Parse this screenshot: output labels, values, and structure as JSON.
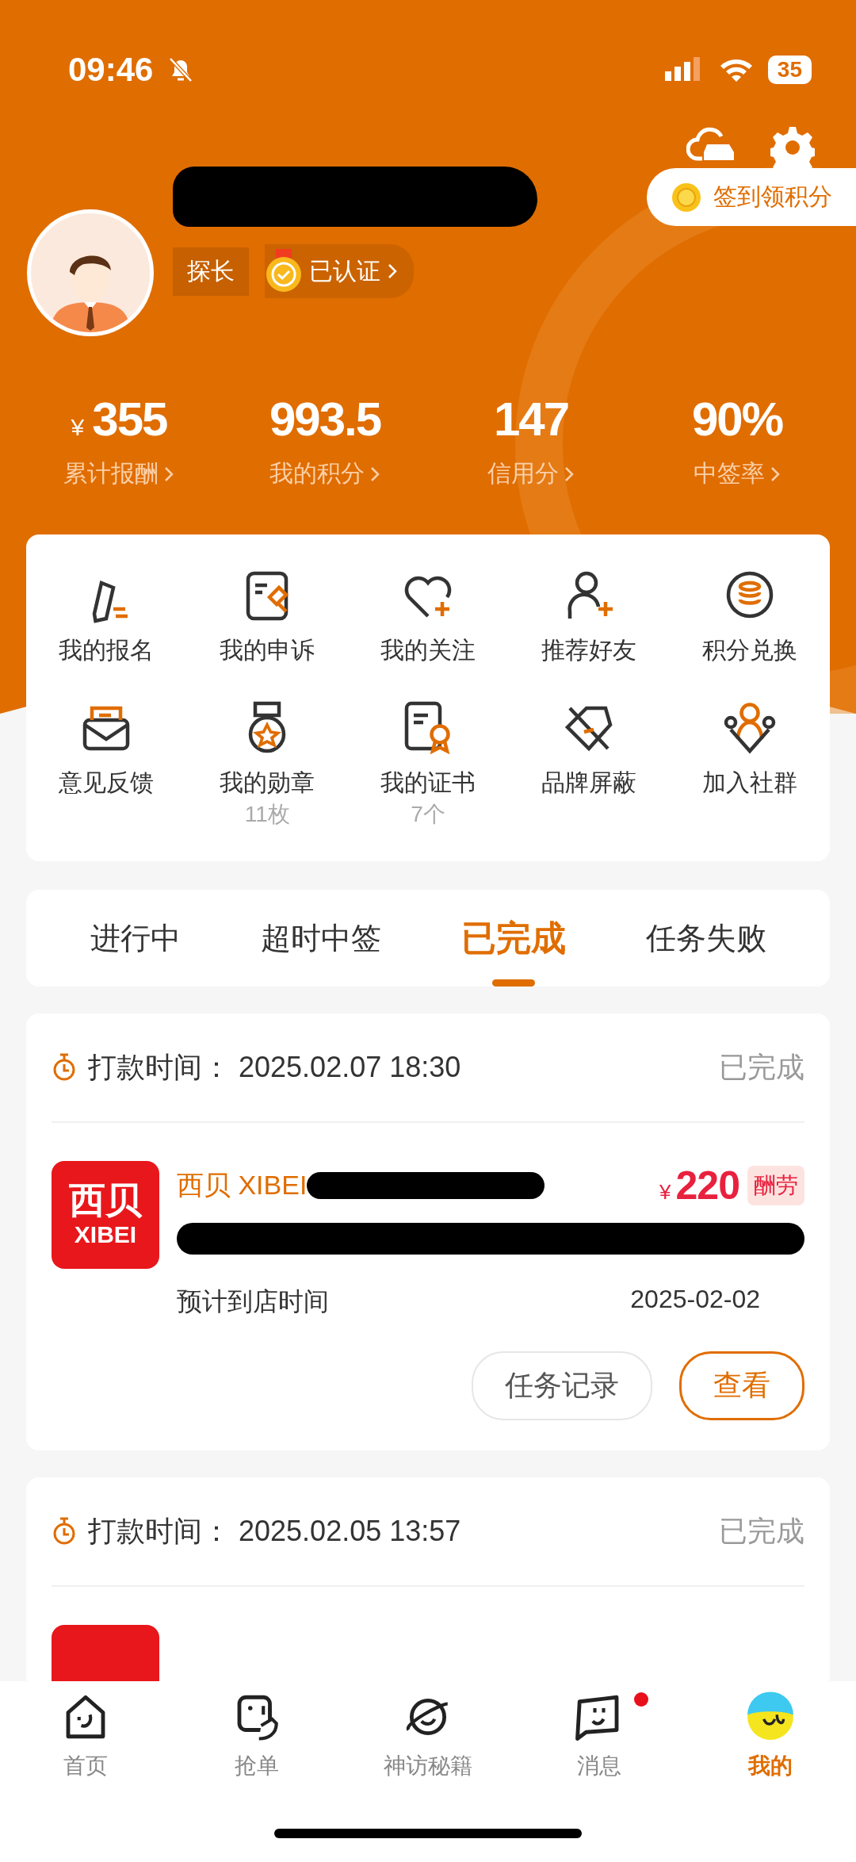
{
  "status_bar": {
    "time": "09:46",
    "battery": "35"
  },
  "profile": {
    "role": "探长",
    "verified": "已认证",
    "checkin": "签到领积分"
  },
  "stats": [
    {
      "currency": "¥",
      "value": "355",
      "label": "累计报酬"
    },
    {
      "value": "993.5",
      "label": "我的积分"
    },
    {
      "value": "147",
      "label": "信用分"
    },
    {
      "value": "90%",
      "label": "中签率"
    }
  ],
  "shortcuts": [
    {
      "label": "我的报名"
    },
    {
      "label": "我的申诉"
    },
    {
      "label": "我的关注"
    },
    {
      "label": "推荐好友"
    },
    {
      "label": "积分兑换"
    },
    {
      "label": "意见反馈"
    },
    {
      "label": "我的勋章",
      "sub": "11枚"
    },
    {
      "label": "我的证书",
      "sub": "7个"
    },
    {
      "label": "品牌屏蔽"
    },
    {
      "label": "加入社群"
    }
  ],
  "tabs": [
    {
      "label": "进行中",
      "selected": false
    },
    {
      "label": "超时中签",
      "selected": false
    },
    {
      "label": "已完成",
      "selected": true
    },
    {
      "label": "任务失败",
      "selected": false
    }
  ],
  "tasks": [
    {
      "payment_label": "打款时间：",
      "payment_time": "2025.02.07 18:30",
      "status": "已完成",
      "brand": "西贝 XIBEI",
      "logo_top": "西贝",
      "logo_bottom": "XIBEI",
      "currency": "¥",
      "price": "220",
      "price_tag": "酬劳",
      "eta_label": "预计到店时间",
      "eta": "2025-02-02",
      "buttons": [
        "任务记录",
        "查看"
      ]
    },
    {
      "payment_label": "打款时间：",
      "payment_time": "2025.02.05 13:57",
      "status": "已完成"
    }
  ],
  "nav": [
    {
      "label": "首页",
      "selected": false,
      "dot": false
    },
    {
      "label": "抢单",
      "selected": false,
      "dot": false
    },
    {
      "label": "神访秘籍",
      "selected": false,
      "dot": false
    },
    {
      "label": "消息",
      "selected": false,
      "dot": true
    },
    {
      "label": "我的",
      "selected": true,
      "dot": false
    }
  ]
}
